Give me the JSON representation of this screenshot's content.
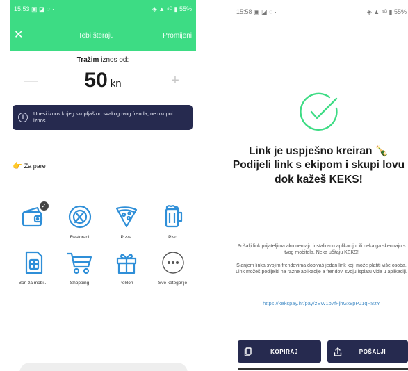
{
  "left": {
    "status_bar": {
      "time": "15:53 ▣ ◪ ◌ ·",
      "right": "◈ ▲ ⁴ᴳ ▮ 55%"
    },
    "header": {
      "title": "Tebi šteraju",
      "action": "Promijeni",
      "close_icon": "close-icon"
    },
    "request": {
      "label_bold": "Tražim",
      "label_rest": "iznos od:",
      "amount": "50",
      "currency": "kn",
      "minus": "—",
      "plus": "+"
    },
    "info": {
      "icon": "i",
      "text": "Unesi iznos kojeg skupljaš od svakog tvog frenda, ne ukupni iznos."
    },
    "purpose": {
      "emoji": "👉",
      "text": "Za pare"
    },
    "categories": [
      {
        "label": "",
        "icon": "wallet-icon",
        "selected": true
      },
      {
        "label": "Restorani",
        "icon": "restaurant-icon",
        "selected": false
      },
      {
        "label": "Pizza",
        "icon": "pizza-icon",
        "selected": false
      },
      {
        "label": "Pivo",
        "icon": "beer-icon",
        "selected": false
      },
      {
        "label": "Bon za mobi...",
        "icon": "sim-card-icon",
        "selected": false
      },
      {
        "label": "Shopping",
        "icon": "shopping-cart-icon",
        "selected": false
      },
      {
        "label": "Poklon",
        "icon": "gift-icon",
        "selected": false
      },
      {
        "label": "Sve kategorije",
        "icon": "more-icon",
        "selected": false
      }
    ],
    "colors": {
      "brand": "#3ddc84",
      "dark": "#262a4f",
      "icon": "#2f8fd8"
    }
  },
  "right": {
    "status_bar": {
      "time": "15:58 ▣ ◪ ◌ ·",
      "right": "◈ ▲ ⁴ᴳ ▮ 55%"
    },
    "success": {
      "line1": "Link je uspješno kreiran 🍾",
      "line2": "Podijeli link s ekipom i skupi lovu",
      "line3": "dok kažeš KEKS!"
    },
    "desc1": "Pošalji link prijateljima ako nemaju instaliranu aplikaciju, ili neka ga skeniraju s tvog mobitela. Neka učitaju KEKS!",
    "desc2": "Slanjem linka svojim frendovima dobivaš jedan link koji može platiti više osoba. Link možeš podijeliti na razne aplikacije a frendovi svoju isplatu vide u aplikaciji.",
    "link": "https://kekspay.hr/pay/zEW1b7fFjhGx8pPJ1qR8zY",
    "buttons": {
      "copy": "KOPIRAJ",
      "send": "POŠALJI"
    }
  }
}
